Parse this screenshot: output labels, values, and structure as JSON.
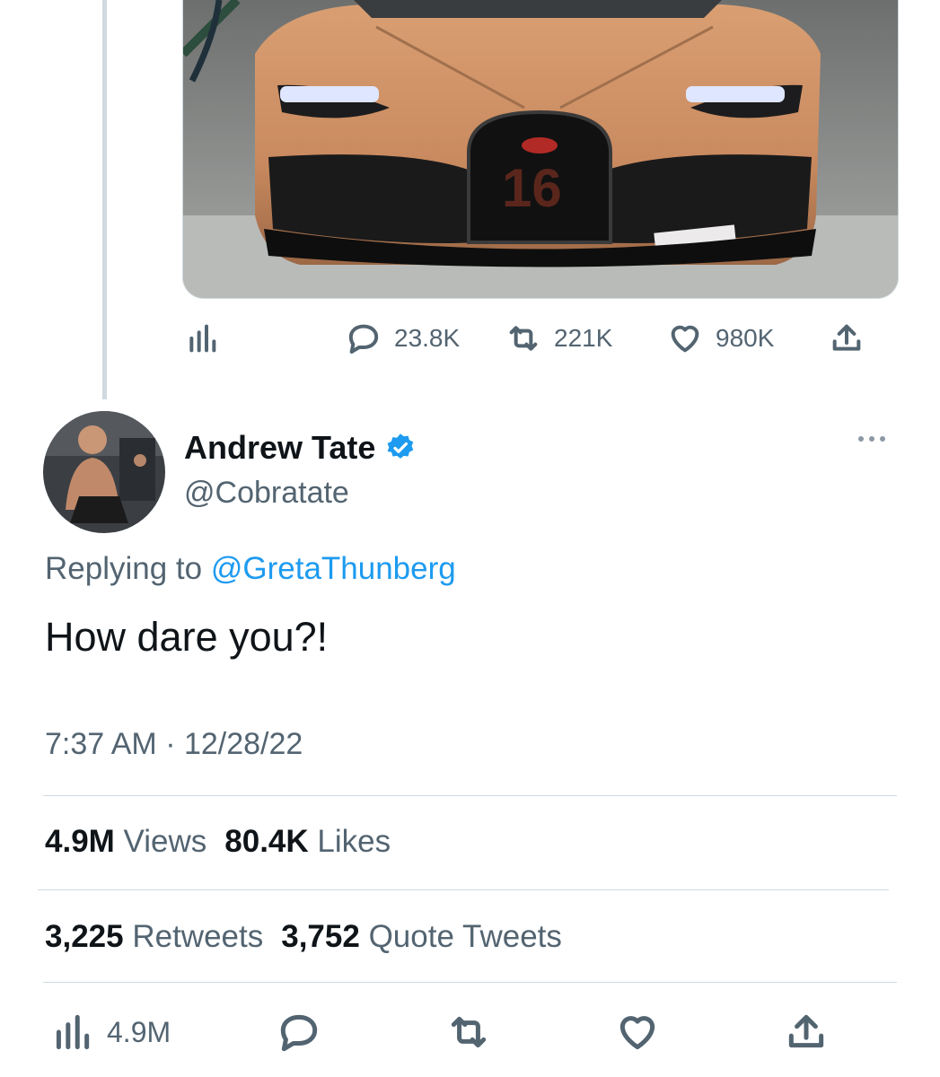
{
  "top_tweet": {
    "metrics": {
      "replies": "23.8K",
      "retweets": "221K",
      "likes": "980K"
    }
  },
  "tweet": {
    "author_name": "Andrew Tate",
    "author_handle": "@Cobratate",
    "verified": true,
    "replying_prefix": "Replying to",
    "replying_to": "@GretaThunberg",
    "text": "How dare you?!",
    "timestamp": "7:37 AM · 12/28/22"
  },
  "stats": {
    "views_count": "4.9M",
    "views_label": "Views",
    "likes_count": "80.4K",
    "likes_label": "Likes",
    "retweets_count": "3,225",
    "retweets_label": "Retweets",
    "quotes_count": "3,752",
    "quotes_label": "Quote Tweets"
  },
  "bottom_actions": {
    "views": "4.9M"
  },
  "colors": {
    "accent": "#1d9bf0",
    "secondary_text": "#536471",
    "primary_text": "#0f1419",
    "divider": "#cfd9de"
  },
  "icons": [
    "analytics-icon",
    "reply-icon",
    "retweet-icon",
    "like-icon",
    "share-icon",
    "verified-badge-icon",
    "more-icon"
  ]
}
